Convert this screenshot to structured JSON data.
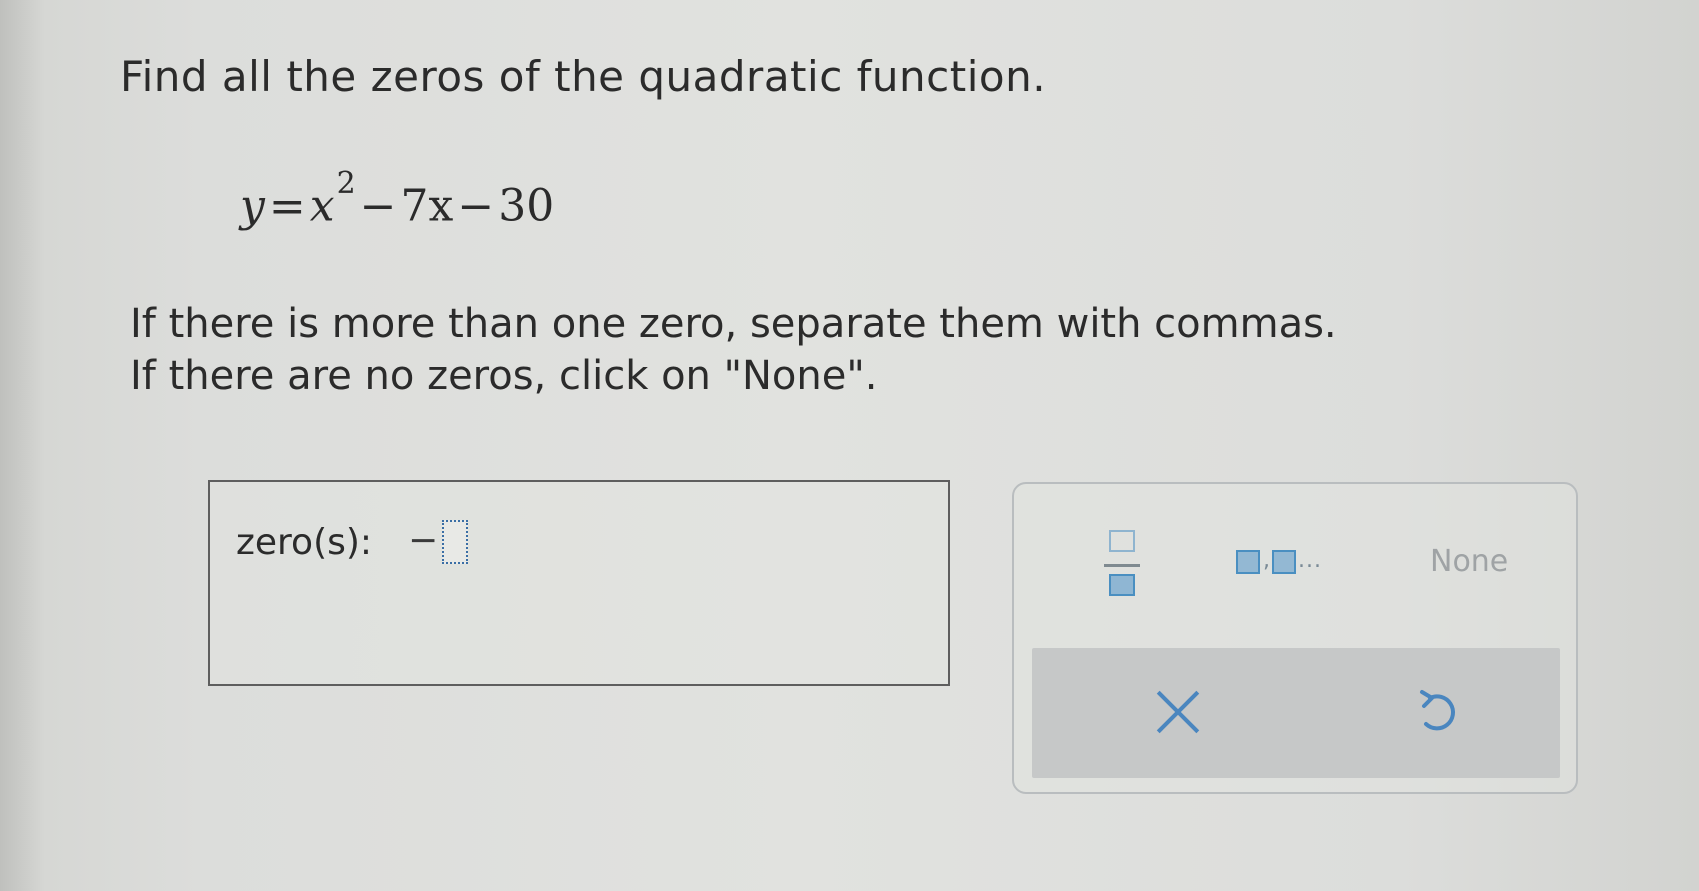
{
  "question": {
    "prompt": "Find all the zeros of the quadratic function.",
    "equation": {
      "lhs": "y",
      "equals": "=",
      "base": "x",
      "exponent": "2",
      "minus1": "−",
      "term2": "7x",
      "minus2": "−",
      "constant": "30"
    },
    "instruction_line1": "If there is more than one zero, separate them with commas.",
    "instruction_line2": "If there are no zeros, click on \"None\"."
  },
  "answer": {
    "label": "zero(s):",
    "current_value": "−"
  },
  "keypad": {
    "list_dots": "...",
    "list_comma": ",",
    "none_label": "None"
  },
  "colors": {
    "accent": "#4a86bf",
    "key_fill": "#93b8d3",
    "action_bar": "#c6c8c8"
  },
  "icons": {
    "fraction": "fraction-icon",
    "list": "list-icon",
    "clear": "close-icon",
    "undo": "undo-icon"
  }
}
